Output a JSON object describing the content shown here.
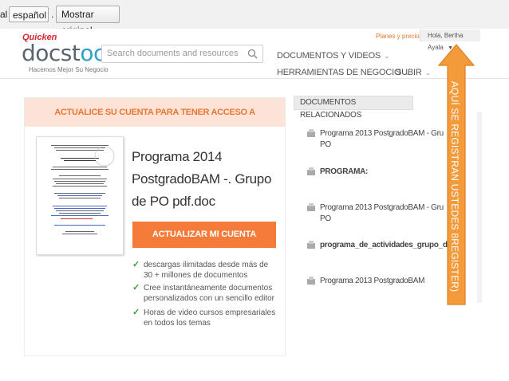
{
  "translate_bar": {
    "left_fragment": "al",
    "language": "español",
    "separator": ".",
    "show_original": "Mostrar original"
  },
  "header": {
    "brand_top": "Quicken",
    "logo_a": "docst",
    "logo_b": "oc",
    "tagline": "Hacemos Mejor Su Negocio",
    "search_placeholder": "Search documents and resources",
    "nav": [
      {
        "label": "DOCUMENTOS Y VIDEOS"
      },
      {
        "label": "HERRAMIENTAS DE NEGOCIO"
      },
      {
        "label": "SUBIR"
      }
    ],
    "plans": "Planes y precios",
    "user": "Hola, Bertha Ayala"
  },
  "card": {
    "heading": "ACTUALICE SU CUENTA PARA TENER ACCESO A",
    "doc_title": "Programa 2014 PostgradoBAM -. Grupo de PO pdf.doc",
    "button": "ACTUALIZAR MI CUENTA",
    "benefits": [
      "descargas ilimitadas desde más de 30 + millones de documentos",
      "Cree instantáneamente documentos personalizados con un sencillo editor",
      "Horas de video cursos empresariales en todos los temas"
    ]
  },
  "related": {
    "heading": "DOCUMENTOS RELACIONADOS",
    "items": [
      {
        "line1": "Programa 2013 PostgradoBAM - Gru",
        "line2": "PO",
        "bold": false
      },
      {
        "line1": "PROGRAMA:",
        "line2": "",
        "bold": true
      },
      {
        "line1": "Programa 2013 PostgradoBAM - Gru",
        "line2": "PO",
        "bold": false
      },
      {
        "line1": "programa_de_actividades_grupo_de_",
        "line2": "",
        "bold": true
      },
      {
        "line1": "Programa 2013 PostgradoBAM",
        "line2": "",
        "bold": false
      }
    ]
  },
  "annotation": {
    "text": "AQUÍ SE REGISTRAN USTEDES 8REGISTER)",
    "color": "#f39a3a"
  },
  "colors": {
    "accent_orange": "#f47b3a",
    "header_peach": "#fbe3d7",
    "logo_blue": "#2fa3c6"
  },
  "icons": [
    "search-icon",
    "chevron-down-icon",
    "document-icon",
    "checkmark-icon",
    "arrow-up-icon"
  ]
}
